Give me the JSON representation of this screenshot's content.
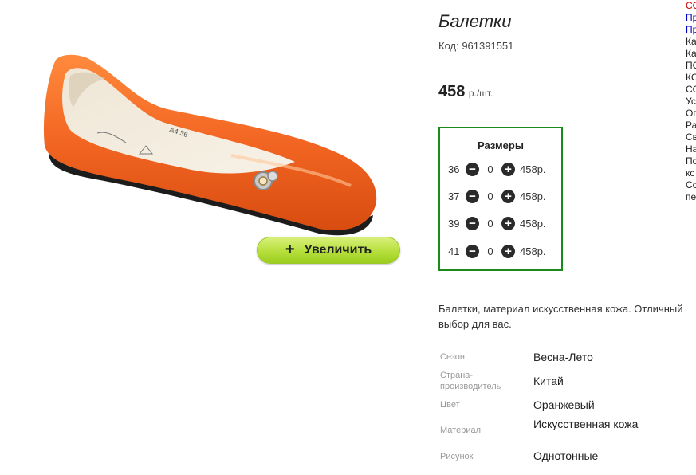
{
  "product": {
    "title": "Балетки",
    "sku": "Код: 961391551",
    "price": "458",
    "price_unit": "р./шт."
  },
  "zoom": {
    "icon": "+",
    "label": "Увеличить"
  },
  "sizes": {
    "title": "Размеры",
    "rows": [
      {
        "size": "36",
        "minus": "−",
        "qty": "0",
        "plus": "+",
        "price": "458р."
      },
      {
        "size": "37",
        "minus": "−",
        "qty": "0",
        "plus": "+",
        "price": "458р."
      },
      {
        "size": "39",
        "minus": "−",
        "qty": "0",
        "plus": "+",
        "price": "458р."
      },
      {
        "size": "41",
        "minus": "−",
        "qty": "0",
        "plus": "+",
        "price": "458р."
      }
    ]
  },
  "description": "Балетки, материал искусственная кожа. Отличный выбор для вас.",
  "specs": [
    {
      "label": "Сезон",
      "value": "Весна-Лето"
    },
    {
      "label": "Страна-производитель",
      "value": "Китай"
    },
    {
      "label": "Цвет",
      "value": "Оранжевый"
    },
    {
      "label": "Материал",
      "value": "Искусственная кожа"
    },
    {
      "label": "Рисунок",
      "value": "Однотонные"
    }
  ],
  "side_links": [
    {
      "text": "СС",
      "color": "#cc0000"
    },
    {
      "text": "Пр",
      "color": "#0000cc"
    },
    {
      "text": "Пр",
      "color": "#0000cc"
    },
    {
      "text": "Ка",
      "color": "#222222"
    },
    {
      "text": "Ка",
      "color": "#222222"
    },
    {
      "text": "ПС",
      "color": "#222222"
    },
    {
      "text": "КС",
      "color": "#222222"
    },
    {
      "text": "СС",
      "color": "#222222"
    },
    {
      "text": "Ус",
      "color": "#222222"
    },
    {
      "text": "Ог",
      "color": "#222222"
    },
    {
      "text": "Ра",
      "color": "#222222"
    },
    {
      "text": "Св",
      "color": "#222222"
    },
    {
      "text": "На",
      "color": "#222222"
    },
    {
      "text": "По",
      "color": "#222222"
    },
    {
      "text": "кс",
      "color": "#222222"
    },
    {
      "text": "Сс",
      "color": "#222222"
    },
    {
      "text": "пе",
      "color": "#222222"
    }
  ],
  "colors": {
    "shoe_orange": "#f26522",
    "sizes_border": "#1a8a1a",
    "zoom_button": "#b6df3c"
  }
}
